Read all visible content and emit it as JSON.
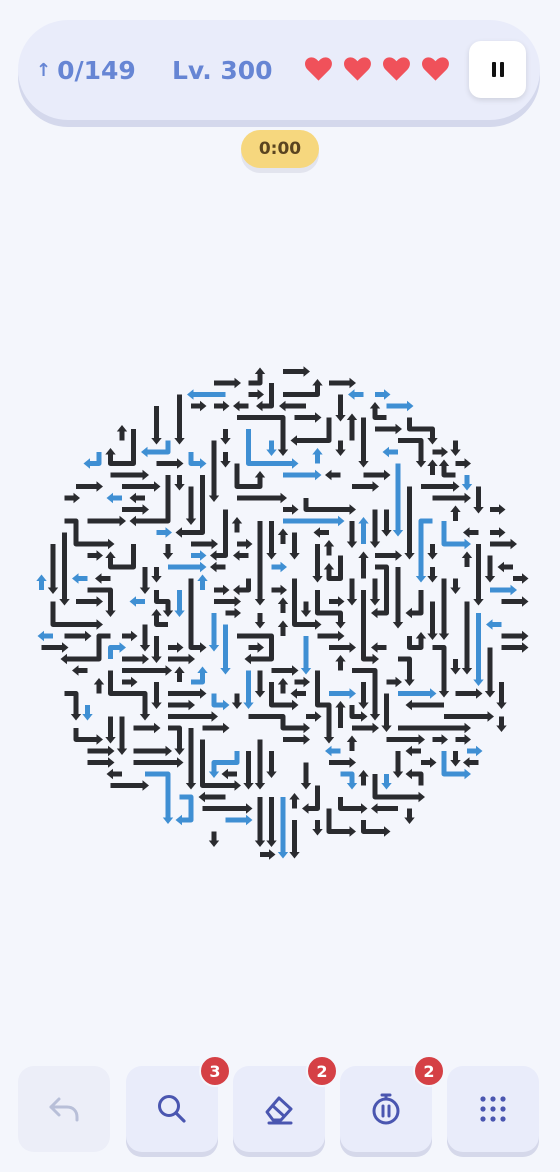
{
  "hud": {
    "moves_text": "0/149",
    "level_text": "Lv. 300",
    "lives": 4,
    "colors": {
      "text": "#6685d4",
      "heart": "#f0515a",
      "panel": "#e9ecfa"
    }
  },
  "timer": {
    "text": "0:00",
    "color": "#f6d77e"
  },
  "board": {
    "shape": "circle",
    "arrow_colors": {
      "default": "#2a2b2f",
      "highlighted": "#3f8fd3"
    }
  },
  "toolbar": {
    "buttons": [
      {
        "name": "undo",
        "icon": "undo-icon",
        "enabled": false
      },
      {
        "name": "hint",
        "icon": "search-icon",
        "badge": "3"
      },
      {
        "name": "eraser",
        "icon": "eraser-icon",
        "badge": "2"
      },
      {
        "name": "freeze",
        "icon": "stopwatch-pause-icon",
        "badge": "2"
      },
      {
        "name": "menu",
        "icon": "grid-dots-icon"
      }
    ]
  }
}
